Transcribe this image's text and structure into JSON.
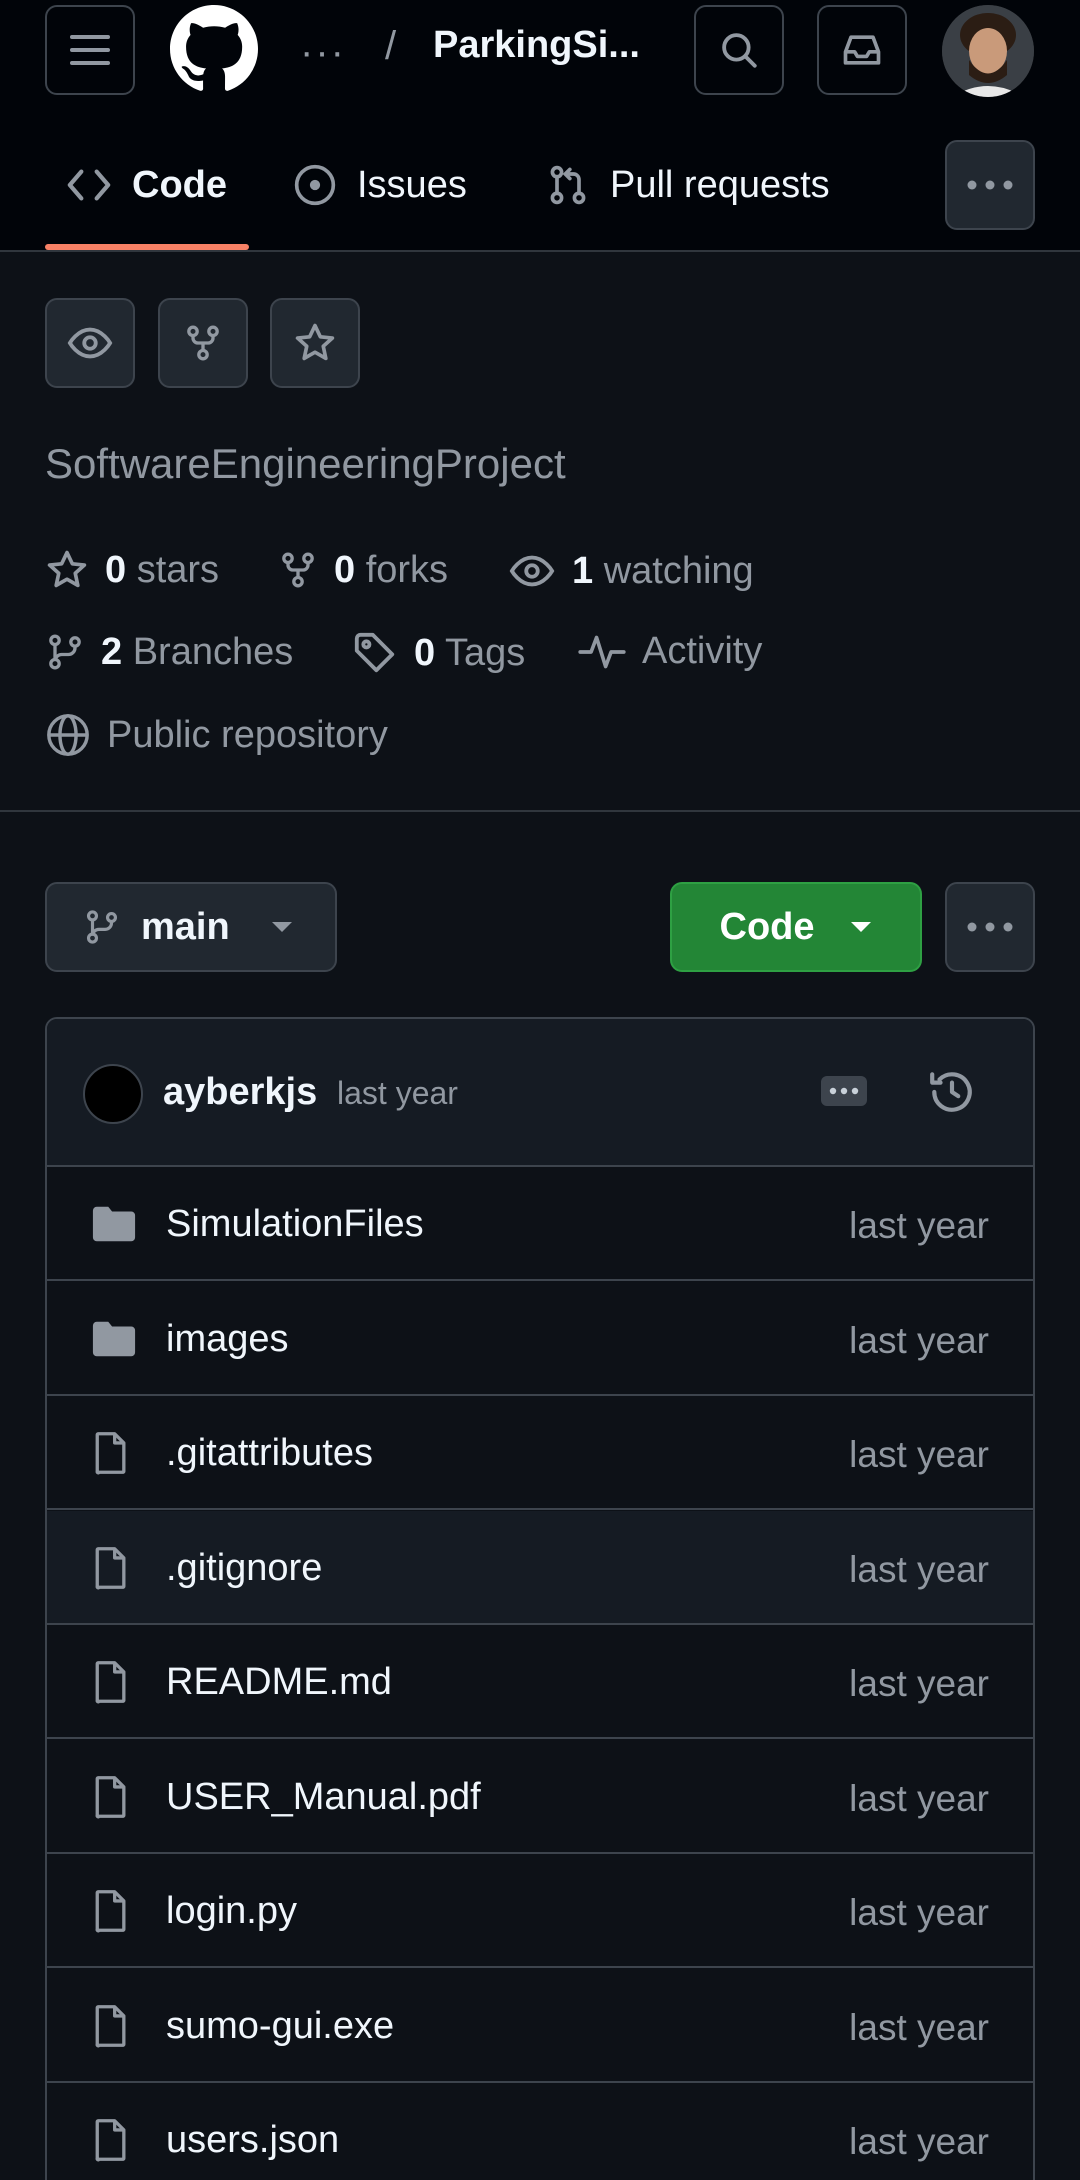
{
  "header": {
    "repo_title": "ParkingSi...",
    "breadcrumb_dots": "···",
    "breadcrumb_sep": "/"
  },
  "tabs": [
    {
      "label": "Code",
      "icon": "code-icon",
      "selected": true
    },
    {
      "label": "Issues",
      "icon": "issue-opened-icon",
      "selected": false
    },
    {
      "label": "Pull requests",
      "icon": "git-pull-request-icon",
      "selected": false
    }
  ],
  "repo": {
    "name": "SoftwareEngineeringProject",
    "stars_count": "0",
    "stars_label": "stars",
    "forks_count": "0",
    "forks_label": "forks",
    "watching_count": "1",
    "watching_label": "watching",
    "branches_count": "2",
    "branches_label": "Branches",
    "tags_count": "0",
    "tags_label": "Tags",
    "activity_label": "Activity",
    "visibility_label": "Public repository"
  },
  "toolbar": {
    "branch": "main",
    "code_label": "Code"
  },
  "commit": {
    "user": "ayberkjs",
    "time": "last year"
  },
  "files": [
    {
      "name": "SimulationFiles",
      "type": "folder",
      "time": "last year"
    },
    {
      "name": "images",
      "type": "folder",
      "time": "last year"
    },
    {
      "name": ".gitattributes",
      "type": "file",
      "time": "last year"
    },
    {
      "name": ".gitignore",
      "type": "file",
      "time": "last year"
    },
    {
      "name": "README.md",
      "type": "file",
      "time": "last year"
    },
    {
      "name": "USER_Manual.pdf",
      "type": "file",
      "time": "last year"
    },
    {
      "name": "login.py",
      "type": "file",
      "time": "last year"
    },
    {
      "name": "sumo-gui.exe",
      "type": "file",
      "time": "last year"
    },
    {
      "name": "users.json",
      "type": "file",
      "time": "last year"
    }
  ],
  "colors": {
    "accent_underline": "#f78166",
    "code_button": "#238636",
    "background": "#0d1117"
  }
}
